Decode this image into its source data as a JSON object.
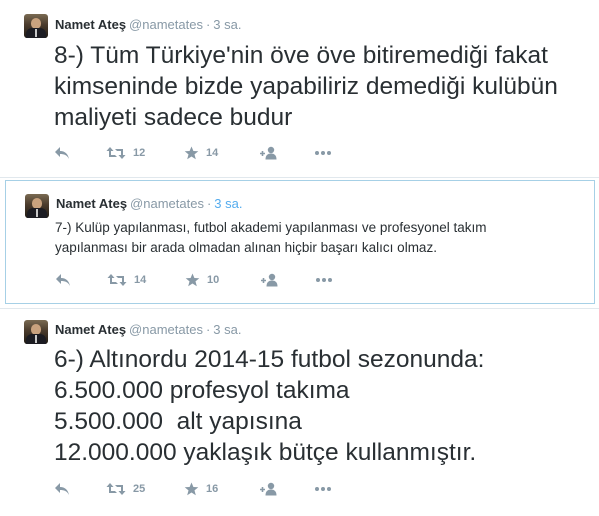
{
  "tweets": [
    {
      "author_name": "Namet Ateş",
      "username": "@nametates",
      "separator": "·",
      "time": "3 sa.",
      "text_lines": [
        "8-) Tüm Türkiye'nin öve öve bitiremediği fakat",
        "kimseninde bizde yapabiliriz demediği kulübün",
        "maliyeti sadece budur"
      ],
      "retweets": "12",
      "favorites": "14"
    },
    {
      "author_name": "Namet Ateş",
      "username": "@nametates",
      "separator": "·",
      "time": "3 sa.",
      "text_lines": [
        "7-) Kulüp yapılanması, futbol akademi yapılanması ve profesyonel takım",
        "yapılanması bir arada olmadan alınan hiçbir başarı kalıcı olmaz."
      ],
      "retweets": "14",
      "favorites": "10"
    },
    {
      "author_name": "Namet Ateş",
      "username": "@nametates",
      "separator": "·",
      "time": "3 sa.",
      "text_lines": [
        "6-) Altınordu 2014-15 futbol sezonunda:",
        "6.500.000 profesyol takıma",
        "5.500.000  alt yapısına",
        "12.000.000 yaklaşık bütçe kullanmıştır."
      ],
      "retweets": "25",
      "favorites": "16"
    }
  ],
  "colors": {
    "text": "#292f33",
    "muted": "#8899a6",
    "accent": "#55acee",
    "selected_border": "#a6d0e6"
  },
  "icons": [
    "reply-icon",
    "retweet-icon",
    "favorite-icon",
    "follow-icon",
    "more-icon"
  ]
}
